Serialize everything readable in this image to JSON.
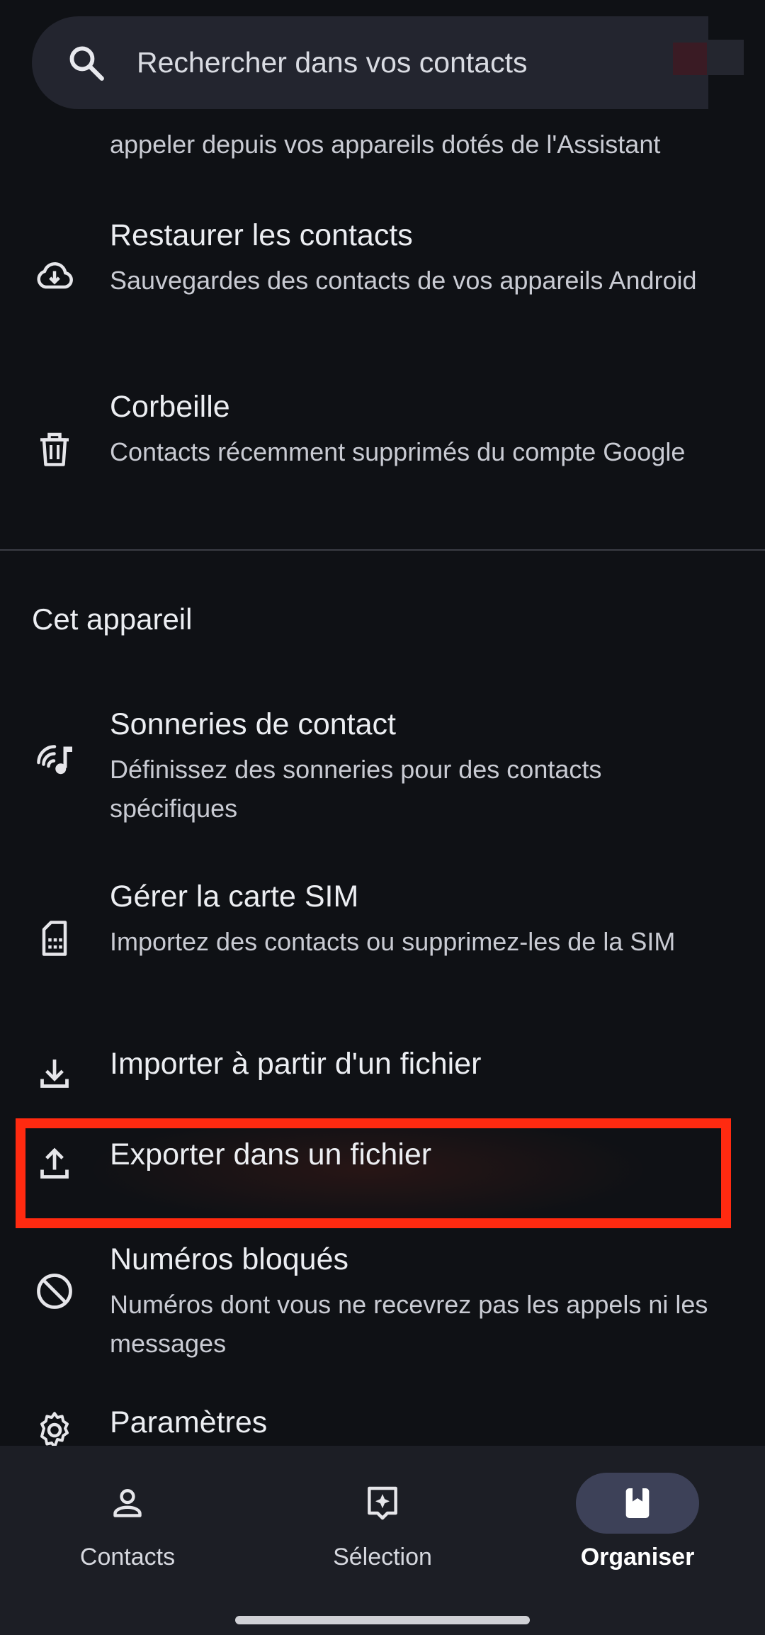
{
  "search": {
    "placeholder": "Rechercher dans vos contacts",
    "icon": "search-icon"
  },
  "list_top": {
    "partial_subtitle": "appeler depuis vos appareils dotés de l'Assistant",
    "items": [
      {
        "title": "Restaurer les contacts",
        "subtitle": "Sauvegardes des contacts de vos appareils Android",
        "icon": "cloud-download-icon"
      },
      {
        "title": "Corbeille",
        "subtitle": "Contacts récemment supprimés du compte Google",
        "icon": "trash-icon"
      }
    ]
  },
  "device_section": {
    "heading": "Cet appareil",
    "items": [
      {
        "title": "Sonneries de contact",
        "subtitle": "Définissez des sonneries pour des contacts spécifiques",
        "icon": "ringtone-icon"
      },
      {
        "title": "Gérer la carte SIM",
        "subtitle": "Importez des contacts ou supprimez-les de la SIM",
        "icon": "sim-card-icon"
      },
      {
        "title": "Importer à partir d'un fichier",
        "icon": "import-icon"
      },
      {
        "title": "Exporter dans un fichier",
        "icon": "export-icon",
        "highlighted": true
      },
      {
        "title": "Numéros bloqués",
        "subtitle": "Numéros dont vous ne recevrez pas les appels ni les messages",
        "icon": "block-icon"
      },
      {
        "title": "Paramètres",
        "icon": "gear-icon"
      }
    ]
  },
  "bottom_nav": {
    "tabs": [
      {
        "label": "Contacts",
        "icon": "person-icon",
        "active": false
      },
      {
        "label": "Sélection",
        "icon": "highlights-icon",
        "active": false
      },
      {
        "label": "Organiser",
        "icon": "bookmark-book-icon",
        "active": true
      }
    ]
  },
  "colors": {
    "background": "#0f1115",
    "search_bg": "#23252f",
    "nav_bg": "#1c1e25",
    "active_pill": "#3d4158",
    "highlight_border": "#ff2a10"
  }
}
